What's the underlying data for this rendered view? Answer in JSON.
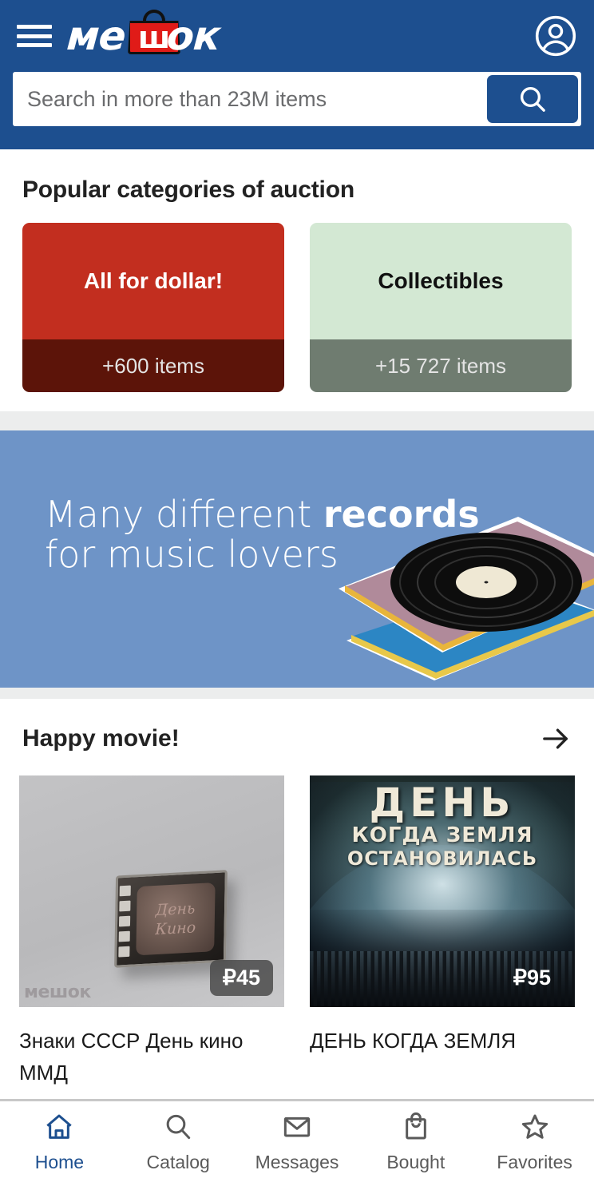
{
  "header": {
    "menu_icon": "hamburger-icon",
    "logo_text_left": "ме",
    "logo_text_bag": "ш",
    "logo_text_right": "ок",
    "account_icon": "account-circle-icon",
    "search": {
      "placeholder": "Search in more than 23M items",
      "value": "",
      "button_icon": "search-icon"
    },
    "bg_color": "#1d4f8f"
  },
  "categories": {
    "title": "Popular categories of auction",
    "items": [
      {
        "label": "All for dollar!",
        "count": "+600 items",
        "bg": "#c22e1f",
        "footer_bg": "#5c1409",
        "text_color": "#ffffff"
      },
      {
        "label": "Collectibles",
        "count": "+15 727 items",
        "bg": "#d3e8d3",
        "footer_bg": "#6f7c70",
        "text_color": "#111111"
      }
    ]
  },
  "banner": {
    "line1_plain": "Many different ",
    "line1_bold": "records",
    "line2": "for music lovers",
    "bg_color": "#6e94c7",
    "art": "vinyl-records-image"
  },
  "products": {
    "title": "Happy movie!",
    "more_icon": "arrow-right-icon",
    "items": [
      {
        "title": "Знаки СССР День кино ММД",
        "price": "₽45",
        "image": "soviet-film-badge-photo",
        "watermark": "мешок",
        "badge_style": "dark"
      },
      {
        "title": "ДЕНЬ КОГДА ЗЕМЛЯ",
        "price": "₽95",
        "image": "movie-poster-photo",
        "poster_line1": "ДЕНЬ",
        "poster_line2": "КОГДА ЗЕМЛЯ",
        "poster_line3": "ОСТАНОВИЛАСЬ",
        "badge_style": "plain"
      }
    ]
  },
  "bottom_nav": {
    "active_color": "#1d4f8f",
    "inactive_color": "#5a5a5a",
    "items": [
      {
        "label": "Home",
        "icon": "home-icon",
        "active": true
      },
      {
        "label": "Catalog",
        "icon": "search-icon",
        "active": false
      },
      {
        "label": "Messages",
        "icon": "envelope-icon",
        "active": false
      },
      {
        "label": "Bought",
        "icon": "shopping-bag-icon",
        "active": false
      },
      {
        "label": "Favorites",
        "icon": "star-icon",
        "active": false
      }
    ]
  }
}
